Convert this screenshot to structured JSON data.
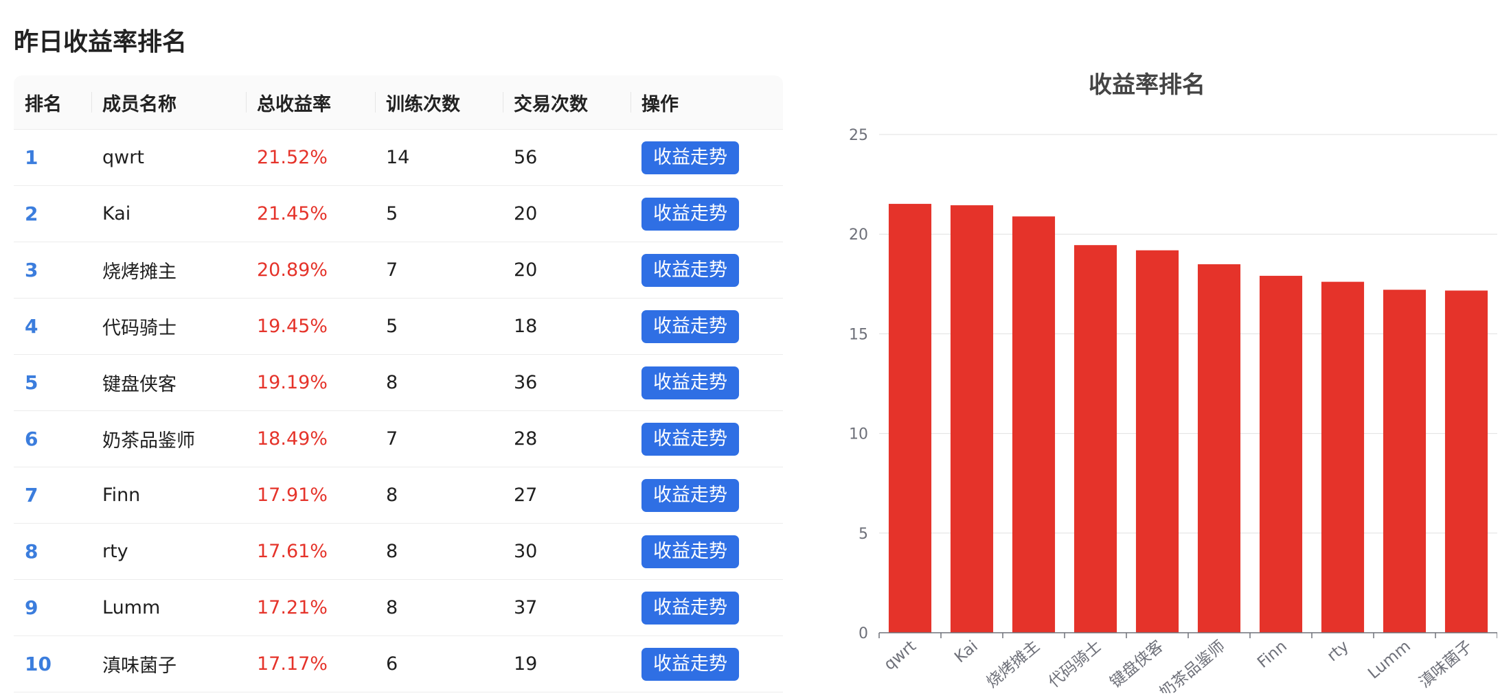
{
  "page": {
    "title": "昨日收益率排名"
  },
  "table": {
    "headers": [
      "排名",
      "成员名称",
      "总收益率",
      "训练次数",
      "交易次数",
      "操作"
    ],
    "rows": [
      {
        "rank": "1",
        "name": "qwrt",
        "rate": "21.52%",
        "train": "14",
        "trade": "56",
        "action": "收益走势"
      },
      {
        "rank": "2",
        "name": "Kai",
        "rate": "21.45%",
        "train": "5",
        "trade": "20",
        "action": "收益走势"
      },
      {
        "rank": "3",
        "name": "烧烤摊主",
        "rate": "20.89%",
        "train": "7",
        "trade": "20",
        "action": "收益走势"
      },
      {
        "rank": "4",
        "name": "代码骑士",
        "rate": "19.45%",
        "train": "5",
        "trade": "18",
        "action": "收益走势"
      },
      {
        "rank": "5",
        "name": "键盘侠客",
        "rate": "19.19%",
        "train": "8",
        "trade": "36",
        "action": "收益走势"
      },
      {
        "rank": "6",
        "name": "奶茶品鉴师",
        "rate": "18.49%",
        "train": "7",
        "trade": "28",
        "action": "收益走势"
      },
      {
        "rank": "7",
        "name": "Finn",
        "rate": "17.91%",
        "train": "8",
        "trade": "27",
        "action": "收益走势"
      },
      {
        "rank": "8",
        "name": "rty",
        "rate": "17.61%",
        "train": "8",
        "trade": "30",
        "action": "收益走势"
      },
      {
        "rank": "9",
        "name": "Lumm",
        "rate": "17.21%",
        "train": "8",
        "trade": "37",
        "action": "收益走势"
      },
      {
        "rank": "10",
        "name": "滇味菌子",
        "rate": "17.17%",
        "train": "6",
        "trade": "19",
        "action": "收益走势"
      }
    ]
  },
  "colors": {
    "accent": "#2f6fe4",
    "rank": "#3b7ddd",
    "rate": "#e5332a",
    "bar": "#e5332a"
  },
  "chart_data": {
    "type": "bar",
    "title": "收益率排名",
    "categories": [
      "qwrt",
      "Kai",
      "烧烤摊主",
      "代码骑士",
      "键盘侠客",
      "奶茶品鉴师",
      "Finn",
      "rty",
      "Lumm",
      "滇味菌子"
    ],
    "values": [
      21.52,
      21.45,
      20.89,
      19.45,
      19.19,
      18.49,
      17.91,
      17.61,
      17.21,
      17.17
    ],
    "yticks": [
      "0",
      "5",
      "10",
      "15",
      "20",
      "25"
    ],
    "ylim": [
      0,
      25
    ],
    "grid": true,
    "color": "#e5332a"
  }
}
